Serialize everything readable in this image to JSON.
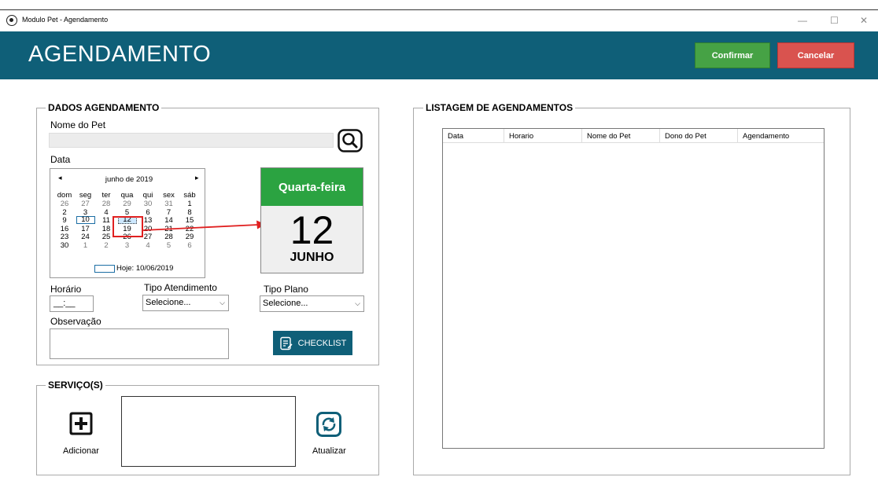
{
  "window": {
    "title": "Modulo Pet - Agendamento",
    "minimize_glyph": "—",
    "maximize_glyph": "☐",
    "close_glyph": "✕"
  },
  "header": {
    "title": "AGENDAMENTO",
    "confirm_label": "Confirmar",
    "cancel_label": "Cancelar",
    "accent": "#0f5f78"
  },
  "dados": {
    "group_label": "DADOS AGENDAMENTO",
    "pet_label": "Nome do Pet",
    "pet_value": "",
    "search_icon": "search-icon",
    "date_label": "Data",
    "calendar": {
      "month_title": "junho de 2019",
      "prev_glyph": "◂",
      "next_glyph": "▸",
      "weekdays": [
        "dom",
        "seg",
        "ter",
        "qua",
        "qui",
        "sex",
        "sáb"
      ],
      "weeks": [
        [
          "26",
          "27",
          "28",
          "29",
          "30",
          "31",
          "1"
        ],
        [
          "2",
          "3",
          "4",
          "5",
          "6",
          "7",
          "8"
        ],
        [
          "9",
          "10",
          "11",
          "12",
          "13",
          "14",
          "15"
        ],
        [
          "16",
          "17",
          "18",
          "19",
          "20",
          "21",
          "22"
        ],
        [
          "23",
          "24",
          "25",
          "26",
          "27",
          "28",
          "29"
        ],
        [
          "30",
          "1",
          "2",
          "3",
          "4",
          "5",
          "6"
        ]
      ],
      "today_label": "Hoje: 10/06/2019",
      "today_day": "10",
      "selected_day": "12"
    },
    "day_card": {
      "weekday": "Quarta-feira",
      "day": "12",
      "month": "JUNHO",
      "color": "#2ba341"
    },
    "horario_label": "Horário",
    "horario_value": "__:__",
    "tipo_atendimento_label": "Tipo Atendimento",
    "tipo_atendimento_value": "Selecione...",
    "tipo_plano_label": "Tipo Plano",
    "tipo_plano_value": "Selecione...",
    "observacao_label": "Observação",
    "observacao_value": "",
    "checklist_label": "CHECKLIST"
  },
  "servicos": {
    "group_label": "SERVIÇO(S)",
    "add_label": "Adicionar",
    "update_label": "Atualizar"
  },
  "listagem": {
    "group_label": "LISTAGEM DE AGENDAMENTOS",
    "columns": [
      "Data",
      "Horario",
      "Nome do Pet",
      "Dono do Pet",
      "Agendamento"
    ]
  }
}
